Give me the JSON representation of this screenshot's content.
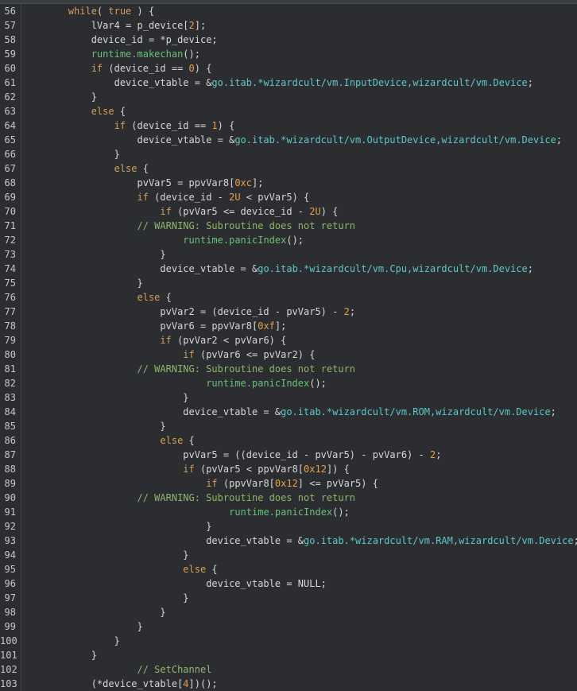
{
  "editor": {
    "lines": [
      {
        "n": "56",
        "tokens": [
          {
            "t": "        "
          },
          {
            "t": "while",
            "c": "kw2"
          },
          {
            "t": "( "
          },
          {
            "t": "true",
            "c": "kw2"
          },
          {
            "t": " ) {"
          }
        ]
      },
      {
        "n": "57",
        "tokens": [
          {
            "t": "            lVar4 = p_device["
          },
          {
            "t": "2",
            "c": "num"
          },
          {
            "t": "];"
          }
        ]
      },
      {
        "n": "58",
        "tokens": [
          {
            "t": "            device_id = *p_device;"
          }
        ]
      },
      {
        "n": "59",
        "tokens": [
          {
            "t": "            "
          },
          {
            "t": "runtime.makechan",
            "c": "fn"
          },
          {
            "t": "();"
          }
        ]
      },
      {
        "n": "60",
        "tokens": [
          {
            "t": "            "
          },
          {
            "t": "if",
            "c": "kw2"
          },
          {
            "t": " (device_id == "
          },
          {
            "t": "0",
            "c": "num"
          },
          {
            "t": ") {"
          }
        ]
      },
      {
        "n": "61",
        "tokens": [
          {
            "t": "                device_vtable = &"
          },
          {
            "t": "go.itab.*wizardcult/vm.InputDevice,wizardcult/vm.Device",
            "c": "type"
          },
          {
            "t": ";"
          }
        ]
      },
      {
        "n": "62",
        "tokens": [
          {
            "t": "            }"
          }
        ]
      },
      {
        "n": "63",
        "tokens": [
          {
            "t": "            "
          },
          {
            "t": "else",
            "c": "kw2"
          },
          {
            "t": " {"
          }
        ]
      },
      {
        "n": "64",
        "tokens": [
          {
            "t": "                "
          },
          {
            "t": "if",
            "c": "kw2"
          },
          {
            "t": " (device_id == "
          },
          {
            "t": "1",
            "c": "num"
          },
          {
            "t": ") {"
          }
        ]
      },
      {
        "n": "65",
        "tokens": [
          {
            "t": "                    device_vtable = &"
          },
          {
            "t": "go.itab.*wizardcult/vm.OutputDevice,wizardcult/vm.Device",
            "c": "type"
          },
          {
            "t": ";"
          }
        ]
      },
      {
        "n": "66",
        "tokens": [
          {
            "t": "                }"
          }
        ]
      },
      {
        "n": "67",
        "tokens": [
          {
            "t": "                "
          },
          {
            "t": "else",
            "c": "kw2"
          },
          {
            "t": " {"
          }
        ]
      },
      {
        "n": "68",
        "tokens": [
          {
            "t": "                    pvVar5 = ppvVar8["
          },
          {
            "t": "0xc",
            "c": "num"
          },
          {
            "t": "];"
          }
        ]
      },
      {
        "n": "69",
        "tokens": [
          {
            "t": "                    "
          },
          {
            "t": "if",
            "c": "kw2"
          },
          {
            "t": " (device_id - "
          },
          {
            "t": "2U",
            "c": "num"
          },
          {
            "t": " < pvVar5) {"
          }
        ]
      },
      {
        "n": "70",
        "tokens": [
          {
            "t": "                        "
          },
          {
            "t": "if",
            "c": "kw2"
          },
          {
            "t": " (pvVar5 <= device_id - "
          },
          {
            "t": "2U",
            "c": "num"
          },
          {
            "t": ") {"
          }
        ]
      },
      {
        "n": "71",
        "tokens": [
          {
            "t": "                    "
          },
          {
            "t": "// WARNING: Subroutine does not return",
            "c": "cm"
          }
        ]
      },
      {
        "n": "72",
        "tokens": [
          {
            "t": "                            "
          },
          {
            "t": "runtime.panicIndex",
            "c": "fn"
          },
          {
            "t": "();"
          }
        ]
      },
      {
        "n": "73",
        "tokens": [
          {
            "t": "                        }"
          }
        ]
      },
      {
        "n": "74",
        "tokens": [
          {
            "t": "                        device_vtable = &"
          },
          {
            "t": "go.itab.*wizardcult/vm.Cpu,wizardcult/vm.Device",
            "c": "type"
          },
          {
            "t": ";"
          }
        ]
      },
      {
        "n": "75",
        "tokens": [
          {
            "t": "                    }"
          }
        ]
      },
      {
        "n": "76",
        "tokens": [
          {
            "t": "                    "
          },
          {
            "t": "else",
            "c": "kw2"
          },
          {
            "t": " {"
          }
        ]
      },
      {
        "n": "77",
        "tokens": [
          {
            "t": "                        pvVar2 = (device_id - pvVar5) - "
          },
          {
            "t": "2",
            "c": "num"
          },
          {
            "t": ";"
          }
        ]
      },
      {
        "n": "78",
        "tokens": [
          {
            "t": "                        pvVar6 = ppvVar8["
          },
          {
            "t": "0xf",
            "c": "num"
          },
          {
            "t": "];"
          }
        ]
      },
      {
        "n": "79",
        "tokens": [
          {
            "t": "                        "
          },
          {
            "t": "if",
            "c": "kw2"
          },
          {
            "t": " (pvVar2 < pvVar6) {"
          }
        ]
      },
      {
        "n": "80",
        "tokens": [
          {
            "t": "                            "
          },
          {
            "t": "if",
            "c": "kw2"
          },
          {
            "t": " (pvVar6 <= pvVar2) {"
          }
        ]
      },
      {
        "n": "81",
        "tokens": [
          {
            "t": "                    "
          },
          {
            "t": "// WARNING: Subroutine does not return",
            "c": "cm"
          }
        ]
      },
      {
        "n": "82",
        "tokens": [
          {
            "t": "                                "
          },
          {
            "t": "runtime.panicIndex",
            "c": "fn"
          },
          {
            "t": "();"
          }
        ]
      },
      {
        "n": "83",
        "tokens": [
          {
            "t": "                            }"
          }
        ]
      },
      {
        "n": "84",
        "tokens": [
          {
            "t": "                            device_vtable = &"
          },
          {
            "t": "go.itab.*wizardcult/vm.ROM,wizardcult/vm.Device",
            "c": "type"
          },
          {
            "t": ";"
          }
        ]
      },
      {
        "n": "85",
        "tokens": [
          {
            "t": "                        }"
          }
        ]
      },
      {
        "n": "86",
        "tokens": [
          {
            "t": "                        "
          },
          {
            "t": "else",
            "c": "kw2"
          },
          {
            "t": " {"
          }
        ]
      },
      {
        "n": "87",
        "tokens": [
          {
            "t": "                            pvVar5 = ((device_id - pvVar5) - pvVar6) - "
          },
          {
            "t": "2",
            "c": "num"
          },
          {
            "t": ";"
          }
        ]
      },
      {
        "n": "88",
        "tokens": [
          {
            "t": "                            "
          },
          {
            "t": "if",
            "c": "kw2"
          },
          {
            "t": " (pvVar5 < ppvVar8["
          },
          {
            "t": "0x12",
            "c": "num"
          },
          {
            "t": "]) {"
          }
        ]
      },
      {
        "n": "89",
        "tokens": [
          {
            "t": "                                "
          },
          {
            "t": "if",
            "c": "kw2"
          },
          {
            "t": " (ppvVar8["
          },
          {
            "t": "0x12",
            "c": "num"
          },
          {
            "t": "] <= pvVar5) {"
          }
        ]
      },
      {
        "n": "90",
        "tokens": [
          {
            "t": "                    "
          },
          {
            "t": "// WARNING: Subroutine does not return",
            "c": "cm"
          }
        ]
      },
      {
        "n": "91",
        "tokens": [
          {
            "t": "                                    "
          },
          {
            "t": "runtime.panicIndex",
            "c": "fn"
          },
          {
            "t": "();"
          }
        ]
      },
      {
        "n": "92",
        "tokens": [
          {
            "t": "                                }"
          }
        ]
      },
      {
        "n": "93",
        "tokens": [
          {
            "t": "                                device_vtable = &"
          },
          {
            "t": "go.itab.*wizardcult/vm.RAM,wizardcult/vm.Device",
            "c": "type"
          },
          {
            "t": ";"
          }
        ]
      },
      {
        "n": "94",
        "tokens": [
          {
            "t": "                            }"
          }
        ]
      },
      {
        "n": "95",
        "tokens": [
          {
            "t": "                            "
          },
          {
            "t": "else",
            "c": "kw2"
          },
          {
            "t": " {"
          }
        ]
      },
      {
        "n": "96",
        "tokens": [
          {
            "t": "                                device_vtable = NULL;"
          }
        ]
      },
      {
        "n": "97",
        "tokens": [
          {
            "t": "                            }"
          }
        ]
      },
      {
        "n": "98",
        "tokens": [
          {
            "t": "                        }"
          }
        ]
      },
      {
        "n": "99",
        "tokens": [
          {
            "t": "                    }"
          }
        ]
      },
      {
        "n": "100",
        "tokens": [
          {
            "t": "                }"
          }
        ]
      },
      {
        "n": "101",
        "tokens": [
          {
            "t": "            }"
          }
        ]
      },
      {
        "n": "102",
        "tokens": [
          {
            "t": "                    "
          },
          {
            "t": "// SetChannel",
            "c": "cm"
          }
        ]
      },
      {
        "n": "103",
        "tokens": [
          {
            "t": "            (*device_vtable["
          },
          {
            "t": "4",
            "c": "num"
          },
          {
            "t": "])();"
          }
        ]
      }
    ]
  },
  "colors": {
    "background": "#2b2d30",
    "keyword": "#d3a05a",
    "number": "#e6a04b",
    "function": "#69c07a",
    "type_ref": "#5fc7c9",
    "comment": "#8fb66a",
    "plain": "#d7d7d7"
  }
}
